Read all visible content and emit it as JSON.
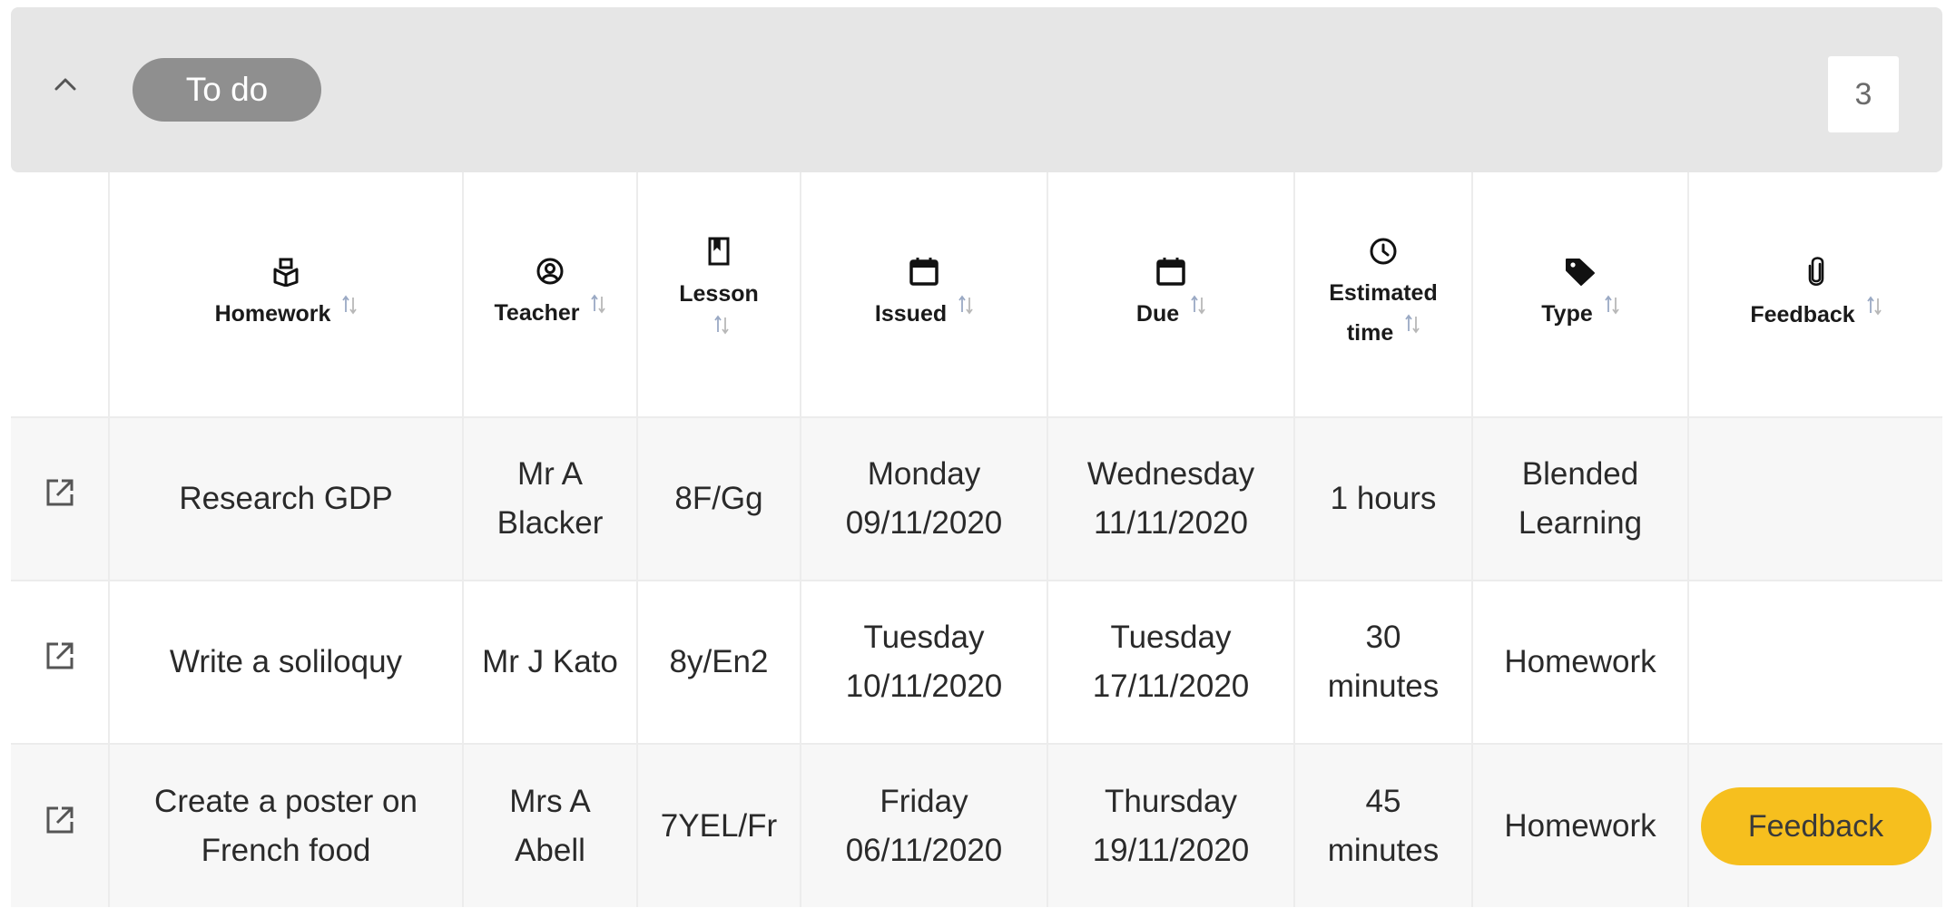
{
  "group": {
    "label": "To do",
    "count": "3",
    "collapse_icon": "chevron-up-icon"
  },
  "columns": [
    {
      "key": "homework",
      "label": "Homework",
      "icon": "homework-book-icon"
    },
    {
      "key": "teacher",
      "label": "Teacher",
      "icon": "user-circle-icon"
    },
    {
      "key": "lesson",
      "label": "Lesson",
      "icon": "bookmark-book-icon"
    },
    {
      "key": "issued",
      "label": "Issued",
      "icon": "calendar-icon"
    },
    {
      "key": "due",
      "label": "Due",
      "icon": "calendar-icon"
    },
    {
      "key": "estimated",
      "label_line1": "Estimated",
      "label_line2": "time",
      "icon": "clock-icon"
    },
    {
      "key": "type",
      "label": "Type",
      "icon": "tag-icon"
    },
    {
      "key": "feedback",
      "label": "Feedback",
      "icon": "paperclip-icon"
    }
  ],
  "rows": [
    {
      "homework_l1": "Research GDP",
      "homework_l2": "",
      "teacher_l1": "Mr A",
      "teacher_l2": "Blacker",
      "lesson": "8F/Gg",
      "issued_day": "Monday",
      "issued_date": "09/11/2020",
      "due_day": "Wednesday",
      "due_date": "11/11/2020",
      "time_l1": "1 hours",
      "time_l2": "",
      "type_l1": "Blended",
      "type_l2": "Learning",
      "feedback": ""
    },
    {
      "homework_l1": "Write a soliloquy",
      "homework_l2": "",
      "teacher_l1": "Mr J Kato",
      "teacher_l2": "",
      "lesson": "8y/En2",
      "issued_day": "Tuesday",
      "issued_date": "10/11/2020",
      "due_day": "Tuesday",
      "due_date": "17/11/2020",
      "time_l1": "30",
      "time_l2": "minutes",
      "type_l1": "Homework",
      "type_l2": "",
      "feedback": ""
    },
    {
      "homework_l1": "Create a poster on",
      "homework_l2": "French food",
      "teacher_l1": "Mrs A",
      "teacher_l2": "Abell",
      "lesson": "7YEL/Fr",
      "issued_day": "Friday",
      "issued_date": "06/11/2020",
      "due_day": "Thursday",
      "due_date": "19/11/2020",
      "time_l1": "45",
      "time_l2": "minutes",
      "type_l1": "Homework",
      "type_l2": "",
      "feedback": "Feedback"
    }
  ],
  "colors": {
    "header_bg": "#e6e6e6",
    "pill_bg": "#8f8f8f",
    "feedback_btn": "#f6bf1e",
    "sort_up": "#9aa9c4",
    "sort_down": "#b8b8b8"
  }
}
